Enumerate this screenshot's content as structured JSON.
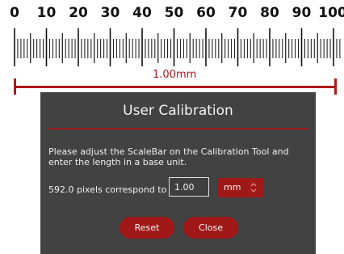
{
  "ruler": {
    "labels": [
      "0",
      "10",
      "20",
      "30",
      "40",
      "50",
      "60",
      "70",
      "80",
      "90",
      "100"
    ]
  },
  "scalebar": {
    "label": "1.00mm",
    "color": "#b0191a"
  },
  "dialog": {
    "title": "User Calibration",
    "instructions": "Please adjust the ScaleBar on the Calibration Tool and enter the length in a base unit.",
    "pixels_label": "592.0 pixels correspond to",
    "length_value": "1.00",
    "unit": "mm",
    "reset_label": "Reset",
    "close_label": "Close",
    "accent_color": "#a01818",
    "background_color": "#424242"
  }
}
